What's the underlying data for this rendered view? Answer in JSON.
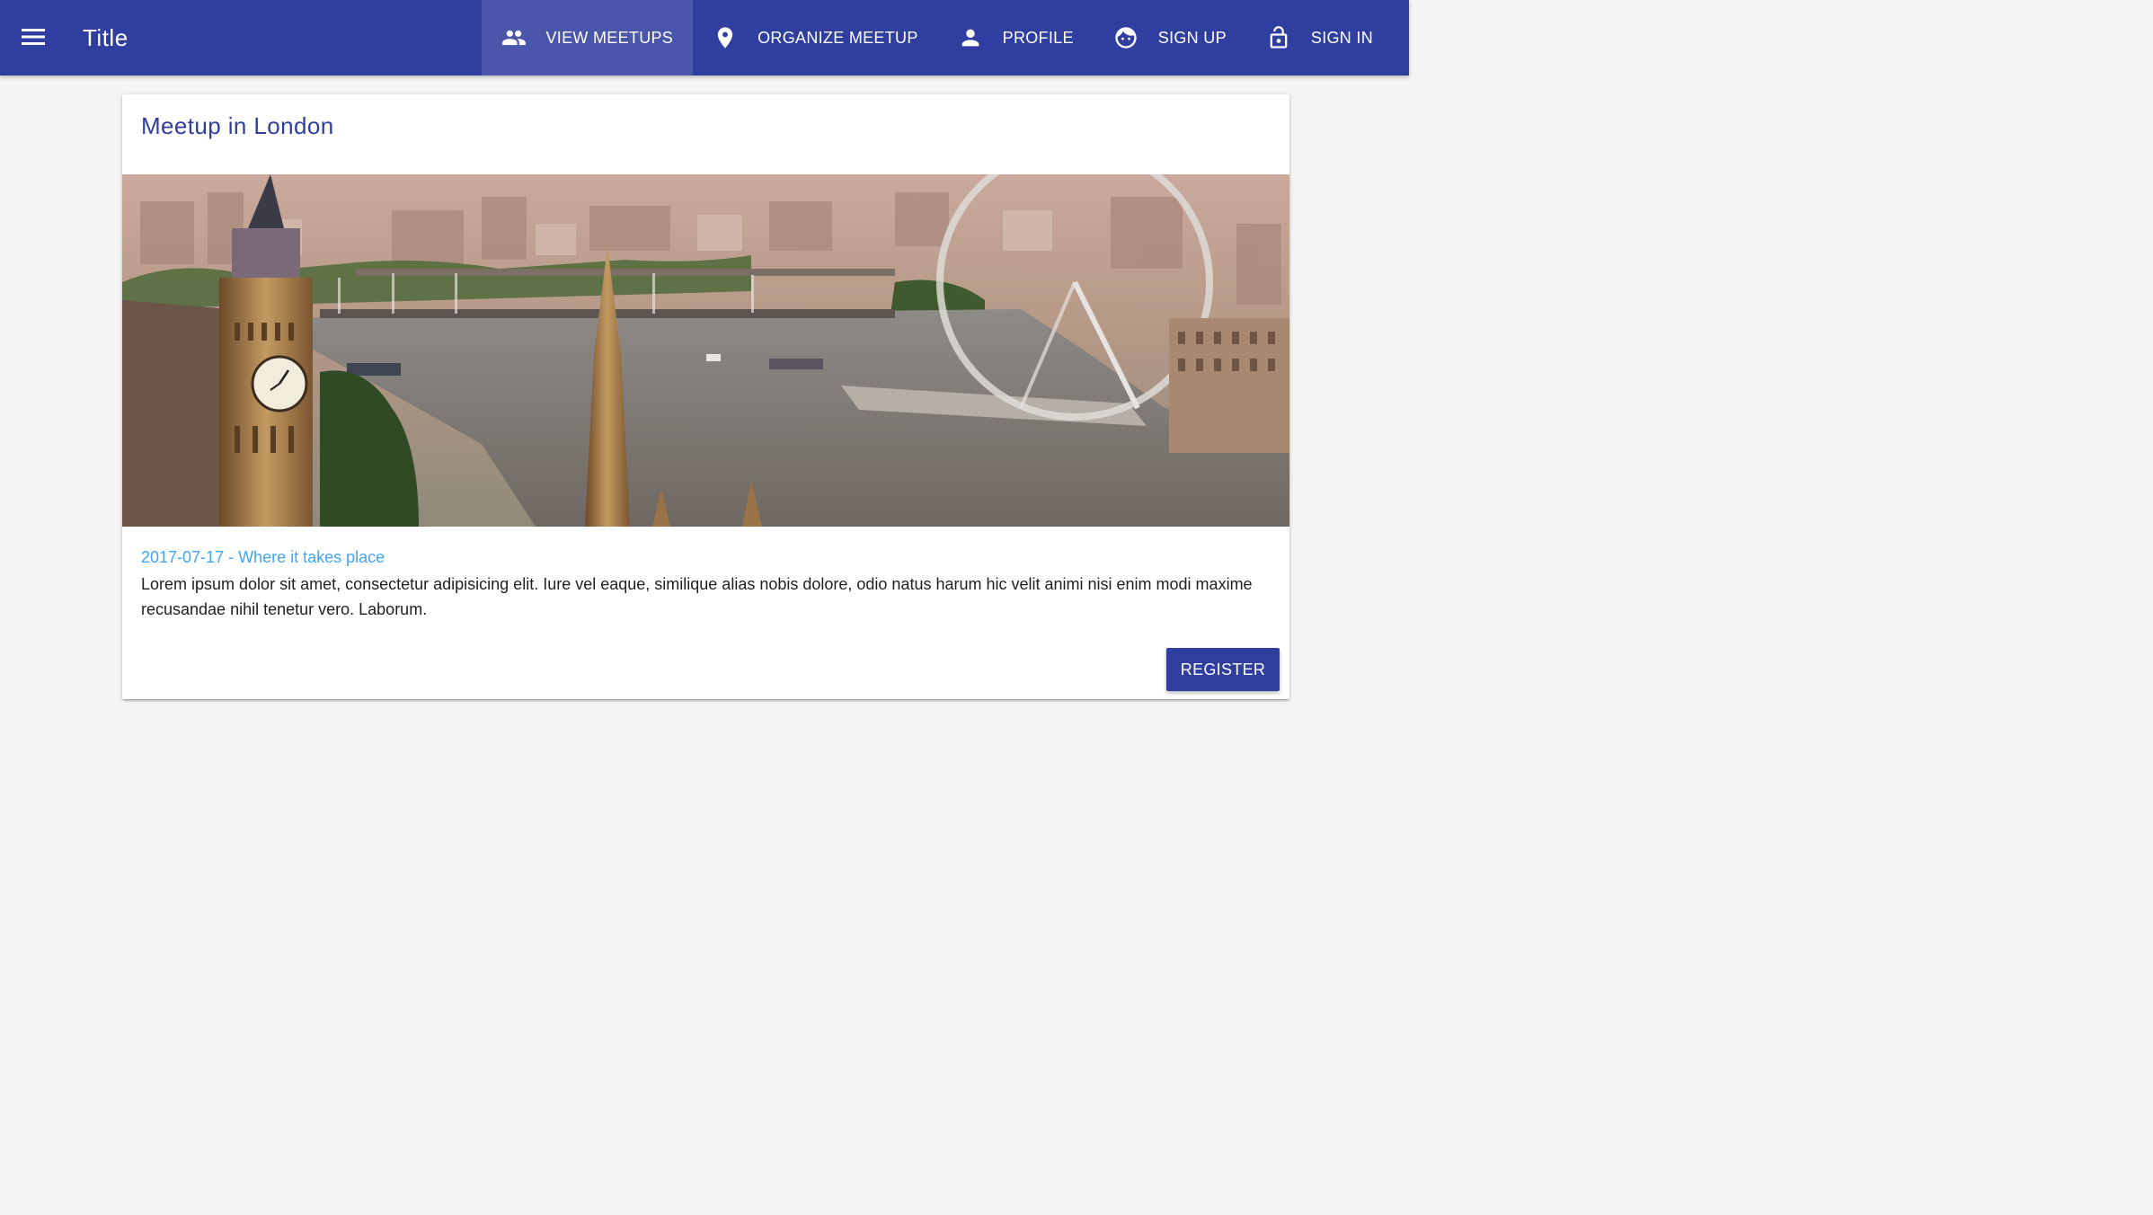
{
  "toolbar": {
    "title": "Title",
    "menu_icon": "menu-icon",
    "background_color": "#303f9f",
    "nav": [
      {
        "label": "VIEW MEETUPS",
        "icon": "people-icon",
        "active": true
      },
      {
        "label": "ORGANIZE MEETUP",
        "icon": "location-pin-icon",
        "active": false
      },
      {
        "label": "PROFILE",
        "icon": "person-icon",
        "active": false
      },
      {
        "label": "SIGN UP",
        "icon": "face-icon",
        "active": false
      },
      {
        "label": "SIGN IN",
        "icon": "lock-open-icon",
        "active": false
      }
    ]
  },
  "meetup": {
    "title": "Meetup in London",
    "meta": "2017-07-17 - Where it takes place",
    "description": "Lorem ipsum dolor sit amet, consectetur adipisicing elit. Iure vel eaque, similique alias nobis dolore, odio natus harum hic velit animi nisi enim modi maxime recusandae nihil tenetur vero. Laborum.",
    "register_label": "REGISTER",
    "title_color": "#303f9f",
    "meta_color": "#42a5f5"
  }
}
